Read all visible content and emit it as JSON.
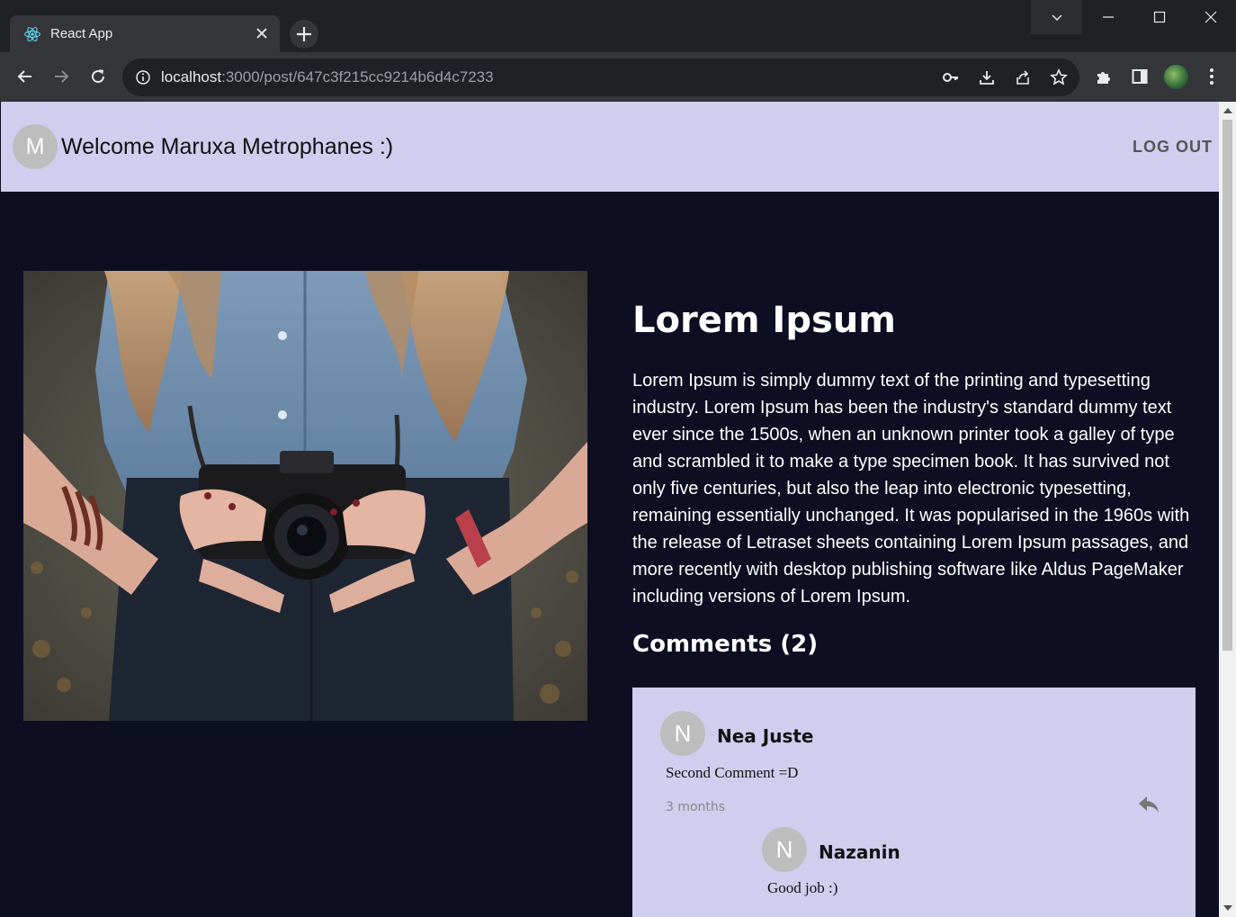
{
  "browser": {
    "tab_title": "React App",
    "url_host": "localhost",
    "url_path": ":3000/post/647c3f215cc9214b6d4c7233",
    "icons": [
      "react-favicon",
      "close-icon",
      "plus-icon",
      "chevron-down-icon",
      "minimize-icon",
      "maximize-icon",
      "close-window-icon",
      "back-arrow-icon",
      "forward-arrow-icon",
      "reload-icon",
      "info-icon",
      "key-icon",
      "install-icon",
      "share-icon",
      "star-icon",
      "puzzle-icon",
      "side-panel-icon",
      "kebab-menu-icon"
    ]
  },
  "header": {
    "avatar_letter": "M",
    "welcome": "Welcome Maruxa Metrophanes :)",
    "logout_label": "LOG OUT",
    "background": "#d0cdee"
  },
  "post": {
    "title": "Lorem Ipsum",
    "body": "Lorem Ipsum is simply dummy text of the printing and typesetting industry. Lorem Ipsum has been the industry's standard dummy text ever since the 1500s, when an unknown printer took a galley of type and scrambled it to make a type specimen book. It has survived not only five centuries, but also the leap into electronic typesetting, remaining essentially unchanged. It was popularised in the 1960s with the release of Letraset sheets containing Lorem Ipsum passages, and more recently with desktop publishing software like Aldus PageMaker including versions of Lorem Ipsum."
  },
  "comments": {
    "heading": "Comments (2)",
    "items": [
      {
        "avatar_letter": "N",
        "author": "Nea Juste",
        "text": "Second Comment =D",
        "time": "3 months"
      },
      {
        "avatar_letter": "N",
        "author": "Nazanin",
        "text": "Good job :)"
      }
    ]
  },
  "colors": {
    "page_bg": "#0e0e22",
    "panel_bg": "#d0cdee",
    "avatar_bg": "#bdbdbd"
  }
}
